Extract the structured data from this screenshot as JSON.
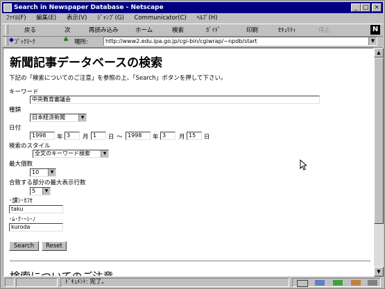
{
  "window": {
    "title": "Search in Newspaper Database - Netscape"
  },
  "menu": [
    "ﾌｧｲﾙ(F)",
    "編集(E)",
    "表示(V)",
    "ｼﾞｬﾝﾌﾟ(G)",
    "Communicator(C)",
    "ﾍﾙﾌﾟ(H)"
  ],
  "toolbar": {
    "back": "戻る",
    "forward": "次",
    "reload": "再読み込み",
    "home": "ホーム",
    "search": "検索",
    "guide": "ｶﾞｲﾄﾞ",
    "print": "印刷",
    "security": "ｾｷｭﾘﾃｨ",
    "stop": "停止"
  },
  "location": {
    "bookmarks": "ﾌﾞｯｸﾏｰｸ",
    "label": "場所:",
    "url": "http://www2.edu.ipa.go.jp/cgi-bin/cgiwrap/~npdb/start"
  },
  "page": {
    "title": "新聞記事データベースの検索",
    "intro": "下記の「検索についてのご注意」を参照の上、「Search」ボタンを押して下さい。",
    "keyword_label": "キーワード",
    "keyword_value": "中央教育審議会",
    "type_label": "種類",
    "type_value": "日本経済新聞",
    "date_label": "日付",
    "date": {
      "from_year": "1998",
      "from_month": "3",
      "from_day": "1",
      "to_year": "1998",
      "to_month": "3",
      "to_day": "15",
      "year_unit": "年",
      "month_unit": "月",
      "day_unit": "日",
      "range_sep": "～"
    },
    "style_label": "検索のスタイル",
    "style_value": "全文のキーワード検索",
    "max_label": "最大個数",
    "max_value": "10",
    "lines_label": "合致する部分の最大表示行数",
    "lines_value": "5",
    "user_label": "･課ｼ･ｶﾌｾ",
    "user_value": "taku",
    "pass_label": "･ﾑ･ｸ･ｰｼ･ﾉ",
    "pass_value": "kuroda",
    "search_button": "Search",
    "reset_button": "Reset",
    "notes_heading": "検索についてのご注意"
  },
  "status": {
    "text": "ﾄﾞｷｭﾒﾝﾄ: 完了。"
  },
  "colors": {
    "titlebar": "#000080",
    "chrome": "#c0c0c0",
    "page_bg": "#ffffff"
  }
}
